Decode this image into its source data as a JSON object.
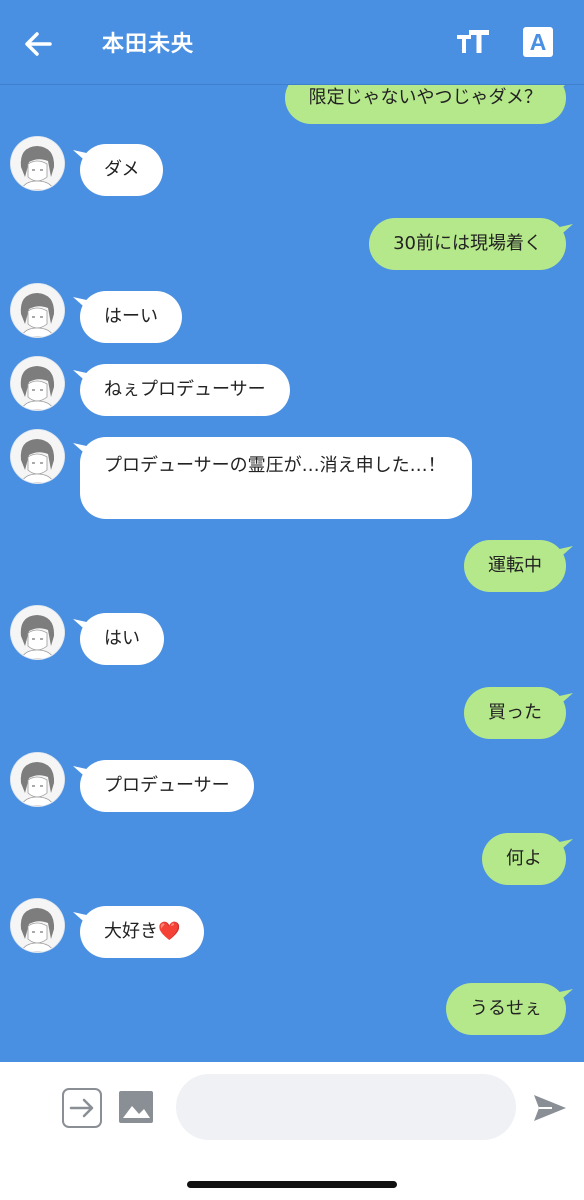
{
  "header": {
    "title": "本田未央",
    "back_icon": "arrow-left-icon",
    "font_size_icon": "text-size-icon",
    "translate_label": "A"
  },
  "messages": [
    {
      "from": "me",
      "text": "限定じゃないやつじゃダメ？"
    },
    {
      "from": "them",
      "text": "ダメ"
    },
    {
      "from": "me",
      "text": "30前には現場着く"
    },
    {
      "from": "them",
      "text": "はーい"
    },
    {
      "from": "them",
      "text": "ねぇプロデューサー"
    },
    {
      "from": "them",
      "text": "プロデューサーの霊圧が…消え申した…！"
    },
    {
      "from": "me",
      "text": "運転中"
    },
    {
      "from": "them",
      "text": "はい"
    },
    {
      "from": "me",
      "text": "買った"
    },
    {
      "from": "them",
      "text": "プロデューサー"
    },
    {
      "from": "me",
      "text": "何よ"
    },
    {
      "from": "them",
      "text": "大好き❤️"
    },
    {
      "from": "me",
      "text": "うるせぇ"
    }
  ],
  "composer": {
    "input_value": "",
    "expand_icon": "expand-arrow-icon",
    "image_icon": "image-icon",
    "send_icon": "send-icon"
  },
  "colors": {
    "background": "#4a90e2",
    "outgoing_bubble": "#b5e88a",
    "incoming_bubble": "#ffffff"
  }
}
